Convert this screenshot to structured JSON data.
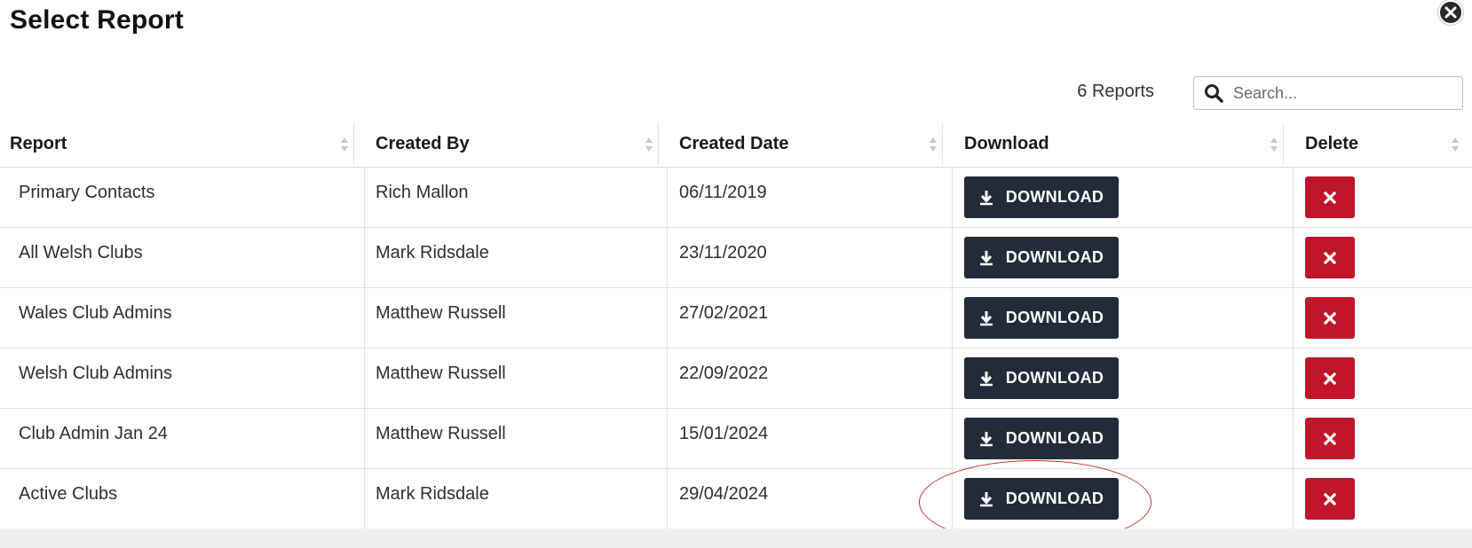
{
  "modal": {
    "title": "Select Report",
    "close_icon": "close-icon"
  },
  "toolbar": {
    "report_count": "6 Reports",
    "search_placeholder": "Search...",
    "search_icon": "search-icon"
  },
  "table": {
    "headers": {
      "report": "Report",
      "created_by": "Created By",
      "created_date": "Created Date",
      "download": "Download",
      "delete": "Delete"
    },
    "download_label": "DOWNLOAD",
    "rows": [
      {
        "report": "Primary Contacts",
        "created_by": "Rich Mallon",
        "created_date": "06/11/2019"
      },
      {
        "report": "All Welsh Clubs",
        "created_by": "Mark Ridsdale",
        "created_date": "23/11/2020"
      },
      {
        "report": "Wales Club Admins",
        "created_by": "Matthew Russell",
        "created_date": "27/02/2021"
      },
      {
        "report": "Welsh Club Admins",
        "created_by": "Matthew Russell",
        "created_date": "22/09/2022"
      },
      {
        "report": "Club Admin Jan 24",
        "created_by": "Matthew Russell",
        "created_date": "15/01/2024"
      },
      {
        "report": "Active Clubs",
        "created_by": "Mark Ridsdale",
        "created_date": "29/04/2024"
      }
    ]
  },
  "colors": {
    "download_button": "#232b3b",
    "delete_button": "#c0162c",
    "highlight": "#c43030"
  }
}
